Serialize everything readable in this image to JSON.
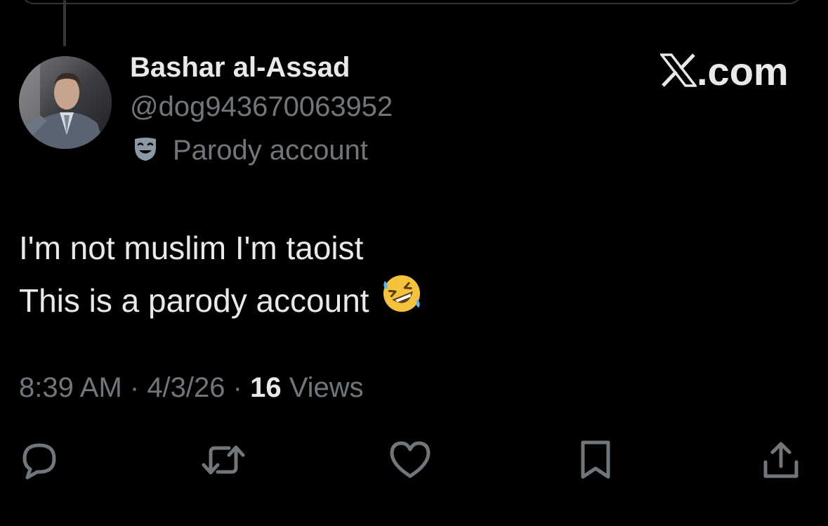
{
  "post": {
    "author": {
      "display_name": "Bashar al-Assad",
      "handle": "@dog943670063952",
      "label_icon": "theater-mask-icon",
      "label": "Parody account"
    },
    "brand": {
      "icon": "x-logo-icon",
      "suffix": ".com"
    },
    "text_lines": [
      "I'm not muslim I'm taoist",
      "This is a parody account"
    ],
    "emoji": "rolling-on-the-floor-laughing-emoji",
    "meta": {
      "time": "8:39 AM",
      "separator": " · ",
      "date": "4/3/26",
      "views_count": "16",
      "views_label": "Views"
    },
    "actions": [
      {
        "name": "reply",
        "icon": "reply-icon"
      },
      {
        "name": "repost",
        "icon": "repost-icon"
      },
      {
        "name": "like",
        "icon": "heart-icon"
      },
      {
        "name": "bookmark",
        "icon": "bookmark-icon"
      },
      {
        "name": "share",
        "icon": "share-icon"
      }
    ]
  },
  "colors": {
    "background": "#000000",
    "primary_text": "#e7e9ea",
    "secondary_text": "#71767b",
    "border": "#2f3336"
  }
}
